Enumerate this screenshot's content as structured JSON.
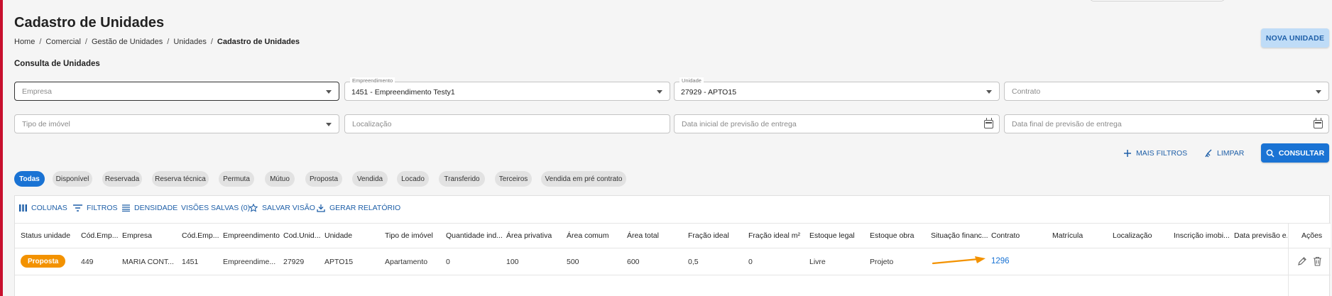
{
  "page": {
    "title": "Cadastro de Unidades",
    "breadcrumb": [
      "Home",
      "Comercial",
      "Gestão de Unidades",
      "Unidades",
      "Cadastro de Unidades"
    ],
    "new_button": "NOVA UNIDADE",
    "section_title": "Consulta de Unidades"
  },
  "filters": {
    "empresa": {
      "placeholder": "Empresa",
      "value": ""
    },
    "empreendimento": {
      "label": "Empreendimento",
      "value": "1451 - Empreendimento Testy1"
    },
    "unidade": {
      "label": "Unidade",
      "value": "27929 - APTO15"
    },
    "contrato": {
      "placeholder": "Contrato",
      "value": ""
    },
    "tipo_imovel": {
      "placeholder": "Tipo de imóvel"
    },
    "localizacao": {
      "placeholder": "Localização"
    },
    "data_inicial": {
      "placeholder": "Data inicial de previsão de entrega"
    },
    "data_final": {
      "placeholder": "Data final de previsão de entrega"
    }
  },
  "actions": {
    "mais_filtros": "MAIS FILTROS",
    "limpar": "LIMPAR",
    "consultar": "CONSULTAR"
  },
  "status_chips": [
    "Todas",
    "Disponível",
    "Reservada",
    "Reserva técnica",
    "Permuta",
    "Mútuo",
    "Proposta",
    "Vendida",
    "Locado",
    "Transferido",
    "Terceiros",
    "Vendida em pré contrato"
  ],
  "active_chip": "Todas",
  "toolbar": {
    "colunas": "COLUNAS",
    "filtros": "FILTROS",
    "densidade": "DENSIDADE",
    "visoes_salvas": "VISÕES SALVAS (0)",
    "salvar_visao": "SALVAR VISÃO",
    "gerar_relatorio": "GERAR RELATÓRIO"
  },
  "table": {
    "columns": [
      "Status unidade",
      "Cód.Emp...",
      "Empresa",
      "Cód.Emp...",
      "Empreendimento",
      "Cod.Unid...",
      "Unidade",
      "Tipo de imóvel",
      "Quantidade ind...",
      "Área privativa",
      "Área comum",
      "Área total",
      "Fração ideal",
      "Fração ideal m²",
      "Estoque legal",
      "Estoque obra",
      "Situação financ...",
      "Contrato",
      "Matrícula",
      "Localização",
      "Inscrição imobi...",
      "Data previsão e...",
      "Ações"
    ],
    "rows": [
      {
        "status": "Proposta",
        "cod_empresa": "449",
        "empresa": "MARIA CONT...",
        "cod_empreend": "1451",
        "empreendimento": "Empreendime...",
        "cod_unidade": "27929",
        "unidade": "APTO15",
        "tipo_imovel": "Apartamento",
        "quantidade": "0",
        "area_privativa": "100",
        "area_comum": "500",
        "area_total": "600",
        "fracao_ideal": "0,5",
        "fracao_ideal_m2": "0",
        "estoque_legal": "Livre",
        "estoque_obra": "Projeto",
        "situacao_financ": "",
        "contrato": "1296",
        "matricula": "",
        "localizacao": "",
        "inscricao": "",
        "data_previsao": ""
      }
    ]
  },
  "colors": {
    "primary": "#1a73d4",
    "primary_light": "#bfdcf7",
    "badge_proposta": "#f39200",
    "annotation_arrow": "#f39200"
  }
}
